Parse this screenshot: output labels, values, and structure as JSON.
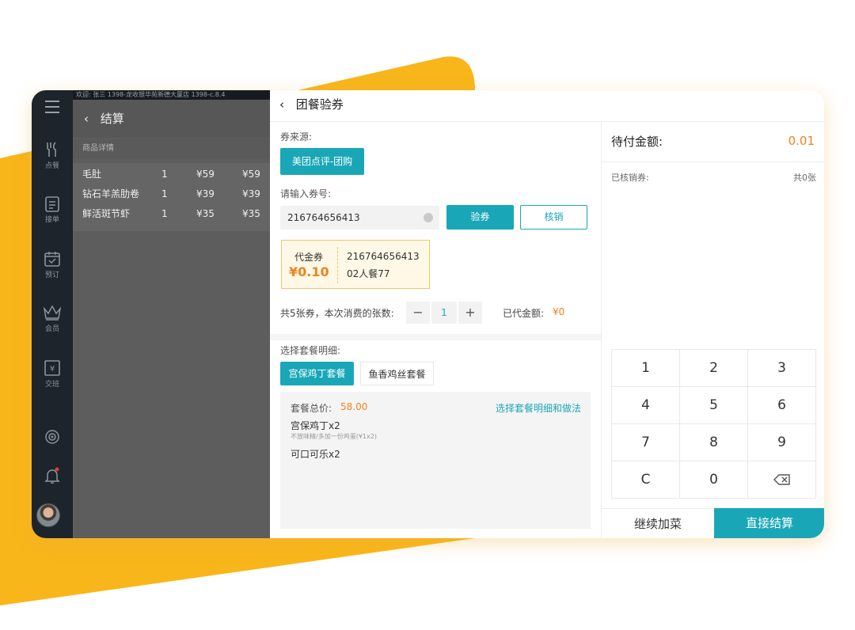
{
  "topbar_text": "欢迎: 张三    1398-龙收银华苑新德大厦店    1398-c.8.4",
  "nav": {
    "items": [
      {
        "label": "点餐",
        "icon": "fork-knife-icon"
      },
      {
        "label": "接单",
        "icon": "clipboard-icon"
      },
      {
        "label": "预订",
        "icon": "calendar-check-icon"
      },
      {
        "label": "会员",
        "icon": "crown-icon"
      },
      {
        "label": "交班",
        "icon": "cash-register-icon"
      }
    ]
  },
  "settle": {
    "title": "结算",
    "subtitle": "商品详情",
    "items": [
      {
        "name": "毛肚",
        "qty": "1",
        "price": "¥59",
        "total": "¥59"
      },
      {
        "name": "钻石羊羔肋卷",
        "qty": "1",
        "price": "¥39",
        "total": "¥39"
      },
      {
        "name": "鲜活斑节虾",
        "qty": "1",
        "price": "¥35",
        "total": "¥35"
      }
    ]
  },
  "panel": {
    "title": "团餐验券",
    "source_label": "券来源:",
    "source_button": "美团点评-团购",
    "code_label": "请输入券号:",
    "code_value": "216764656413",
    "verify_button": "验券",
    "redeem_button": "核销",
    "coupon": {
      "type": "代金券",
      "amount": "¥0.10",
      "code": "216764656413",
      "desc": "02人餐77"
    },
    "count_text": "共5张券，本次消费的张数:",
    "count_value": "1",
    "discount_label": "已代金额:",
    "discount_value": "¥0",
    "package_label": "选择套餐明细:",
    "packages": [
      "宫保鸡丁套餐",
      "鱼香鸡丝套餐"
    ],
    "detail": {
      "total_label": "套餐总价:",
      "total_value": "58.00",
      "link": "选择套餐明细和做法",
      "line1": "宫保鸡丁x2",
      "line1_note": "不放味精/多加一份鸡蛋(¥1x2)",
      "line2": "可口可乐x2"
    }
  },
  "right": {
    "due_label": "待付金额:",
    "due_value": "0.01",
    "redeemed_label": "已核销券:",
    "redeemed_count": "共0张",
    "keys": [
      "1",
      "2",
      "3",
      "4",
      "5",
      "6",
      "7",
      "8",
      "9",
      "C",
      "0",
      ""
    ],
    "continue_button": "继续加菜",
    "checkout_button": "直接结算"
  },
  "colors": {
    "accent": "#19a7b8",
    "orange": "#f0831f",
    "yellow": "#f8b61a"
  }
}
